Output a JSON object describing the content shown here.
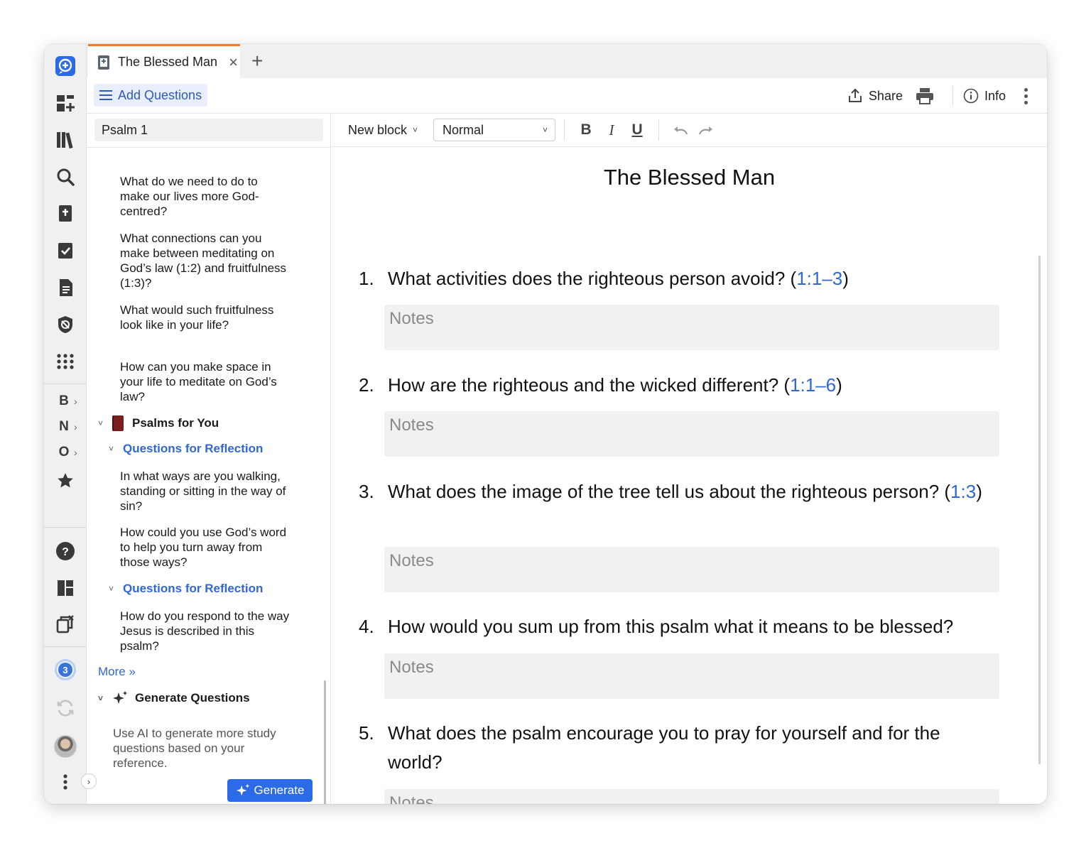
{
  "tab": {
    "title": "The Blessed Man",
    "close": "×",
    "new": "+"
  },
  "toolbar": {
    "add_questions": "Add Questions",
    "share": "Share",
    "info": "Info"
  },
  "left_rail": {
    "letters": [
      "B",
      "N",
      "O"
    ],
    "badge_count": "3"
  },
  "panel": {
    "reference": "Psalm 1",
    "top_questions": [
      "What do we need to do to make our lives more God-centred?",
      "What connections can you make between meditating on God’s law (1:2) and fruitfulness (1:3)?",
      "What would such fruitfulness look like in your life?",
      "How can you make space in your life to meditate on God’s law?"
    ],
    "book_title": "Psalms for You",
    "sections": [
      {
        "title": "Questions for Reflection",
        "questions": [
          "In what ways are you walking, standing or sitting in the way of sin?",
          "How could you use God’s word to help you turn away from those ways?"
        ]
      },
      {
        "title": "Questions for Reflection",
        "questions": [
          "How do you respond to the way Jesus is described in this psalm?"
        ]
      }
    ],
    "more": "More »",
    "generate_title": "Generate Questions",
    "generate_desc": "Use AI to generate more study questions based on your reference.",
    "generate_button": "Generate"
  },
  "editor": {
    "new_block": "New block",
    "style": "Normal",
    "bold": "B",
    "italic": "I",
    "underline": "U",
    "doc_title": "The Blessed Man",
    "notes_placeholder": "Notes",
    "questions": [
      {
        "num": "1.",
        "text": "What activities does the righteous person avoid? (",
        "ref": "1:1–3",
        "close": ")"
      },
      {
        "num": "2.",
        "text": "How are the righteous and the wicked different? (",
        "ref": "1:1–6",
        "close": ")"
      },
      {
        "num": "3.",
        "text": "What does the image of the tree tell us about the righteous person? (",
        "ref": "1:3",
        "close": ")"
      },
      {
        "num": "4.",
        "text": "How would you sum up from this psalm what it means to be blessed?",
        "ref": "",
        "close": ""
      },
      {
        "num": "5.",
        "text": "What does the psalm encourage you to pray for yourself and for the world?",
        "ref": "",
        "close": ""
      }
    ]
  },
  "colors": {
    "accent": "#2f67d6",
    "tab_indicator": "#f07a28",
    "generate_button": "#2b6ae8",
    "book_cover": "#7a1f1f"
  }
}
